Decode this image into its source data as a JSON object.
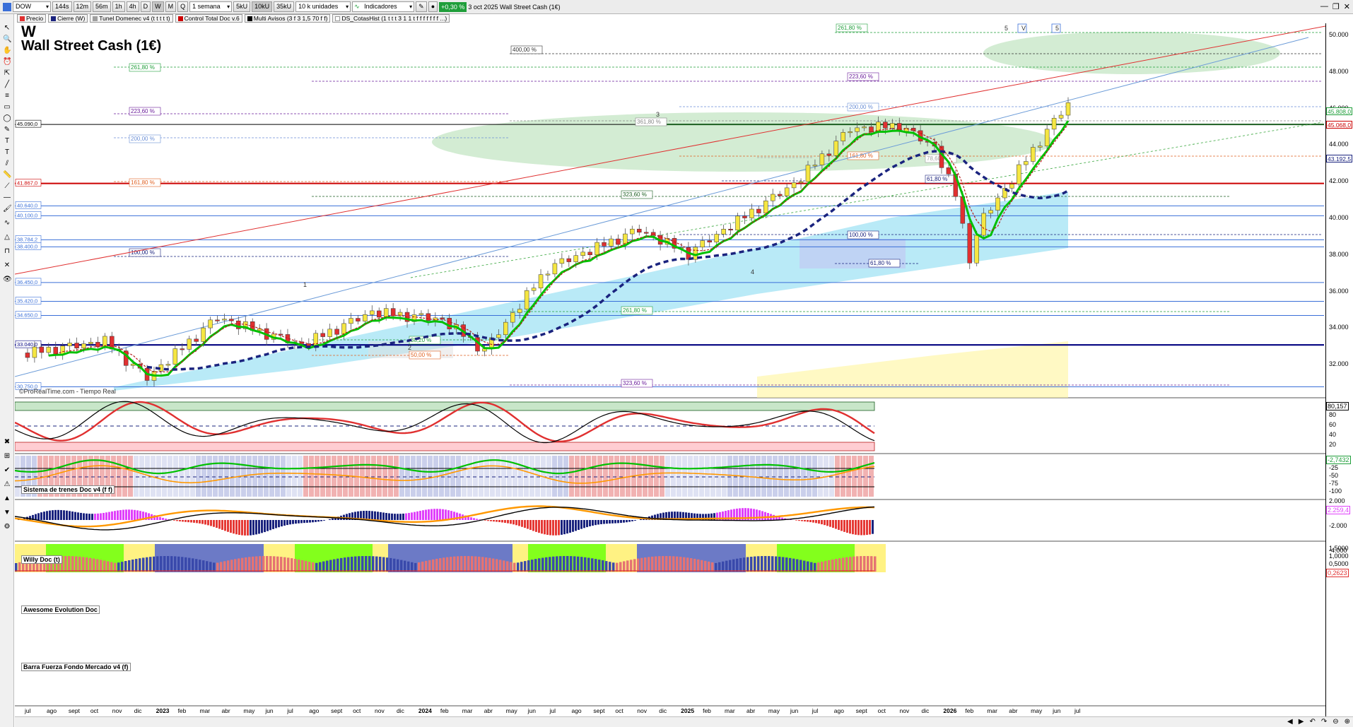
{
  "toolbar": {
    "symbol": "DOW",
    "periods": [
      "144s",
      "12m",
      "56m",
      "1h",
      "4h",
      "D",
      "W",
      "M",
      "Q"
    ],
    "active_period": "W",
    "range": "1 semana",
    "buttons2": [
      "5kU",
      "10kU",
      "35kU"
    ],
    "units": "10 k unidades",
    "indicators": "Indicadores",
    "change_badge": "+0,30 %",
    "date_title": "3 oct 2025 Wall Street Cash (1€)"
  },
  "studies": [
    "Precio",
    "Cierre (W)",
    "Tunel Domenec v4 (t t t t t)",
    "Control Total Doc v.6",
    "Multi Avisos (3 f 3 1,5 70 f f)",
    "DS_CotasHist (1 t t t 3 1 1 t f f f f f f f ...)"
  ],
  "chart_title": {
    "interval": "W",
    "name": "Wall Street Cash (1€)"
  },
  "watermark": "©ProRealTime.com - Tiempo Real",
  "panes": {
    "p1": "Sistema de trenes Doc v4 (f f)",
    "p2": "Willy Doc (t)",
    "p3": "Awesome Evolution Doc",
    "p4": "Barra Fuerza Fondo Mercado v4 (f)"
  },
  "x_labels": [
    "jul",
    "ago",
    "sept",
    "oct",
    "nov",
    "dic",
    "2023",
    "feb",
    "mar",
    "abr",
    "may",
    "jun",
    "jul",
    "ago",
    "sept",
    "oct",
    "nov",
    "dic",
    "2024",
    "feb",
    "mar",
    "abr",
    "may",
    "jun",
    "jul",
    "ago",
    "sept",
    "oct",
    "nov",
    "dic",
    "2025",
    "feb",
    "mar",
    "abr",
    "may",
    "jun",
    "jul",
    "ago",
    "sept",
    "oct",
    "nov",
    "dic",
    "2026",
    "feb",
    "mar",
    "abr",
    "may",
    "jun",
    "jul"
  ],
  "price_axis": [
    "50.000",
    "48.000",
    "46.000",
    "44.000",
    "42.000",
    "40.000",
    "38.000",
    "36.000",
    "34.000",
    "32.000"
  ],
  "price_tags": [
    {
      "text": "45.808,0",
      "color": "#1f9e3a"
    },
    {
      "text": "45.068,0",
      "color": "#cc0000"
    },
    {
      "text": "43.192,5",
      "color": "#1a237e"
    }
  ],
  "left_levels": [
    {
      "text": "45.090,0",
      "color": "#000000"
    },
    {
      "text": "41.867,0",
      "color": "#cc0000"
    },
    {
      "text": "40.640,0",
      "color": "#3a6fd8"
    },
    {
      "text": "40.100,0",
      "color": "#3a6fd8"
    },
    {
      "text": "38.784,2",
      "color": "#3a6fd8"
    },
    {
      "text": "38.400,0",
      "color": "#3a6fd8"
    },
    {
      "text": "36.450,0",
      "color": "#3a6fd8"
    },
    {
      "text": "35.420,0",
      "color": "#3a6fd8"
    },
    {
      "text": "34.650,0",
      "color": "#3a6fd8"
    },
    {
      "text": "33.040,0",
      "color": "#000080"
    },
    {
      "text": "30.750,0",
      "color": "#3a6fd8"
    }
  ],
  "fib_labels": [
    {
      "text": "261,80 %",
      "color": "#1f9e3a"
    },
    {
      "text": "400,00 %",
      "color": "#333333"
    },
    {
      "text": "261,80 %",
      "color": "#1f9e3a"
    },
    {
      "text": "223,60 %",
      "color": "#6a1b9a"
    },
    {
      "text": "223,60 %",
      "color": "#6a1b9a"
    },
    {
      "text": "200,00 %",
      "color": "#6b8fd6"
    },
    {
      "text": "361,80 %",
      "color": "#888888"
    },
    {
      "text": "200,00 %",
      "color": "#6b8fd6"
    },
    {
      "text": "161,80 %",
      "color": "#e06020"
    },
    {
      "text": "161,80 %",
      "color": "#e06020"
    },
    {
      "text": "323,60 %",
      "color": "#1b5e20"
    },
    {
      "text": "100,00 %",
      "color": "#1a237e"
    },
    {
      "text": "100,00 %",
      "color": "#1a237e"
    },
    {
      "text": "61,80 %",
      "color": "#1a237e"
    },
    {
      "text": "61,80 %",
      "color": "#1a237e"
    },
    {
      "text": "78,60 %",
      "color": "#9e9e9e"
    },
    {
      "text": "261,80 %",
      "color": "#1f9e3a"
    },
    {
      "text": "38,20 %",
      "color": "#1f9e3a"
    },
    {
      "text": "50,00 %",
      "color": "#e06020"
    },
    {
      "text": "323,60 %",
      "color": "#6a1b9a"
    }
  ],
  "wave_labels": [
    "1",
    "2",
    "3",
    "4",
    "5",
    "V",
    "5"
  ],
  "osc1_axis": [
    "80",
    "60",
    "40",
    "20"
  ],
  "osc1_value": "80,157",
  "osc2_axis": [
    "-25",
    "-50",
    "-75",
    "-100"
  ],
  "osc2_value": "-2,7432",
  "osc3_axis": [
    "2.000",
    "-2.000",
    "-4.000"
  ],
  "osc3_value": "2.259,4",
  "osc4_axis": [
    "1,5000",
    "1,0000",
    "0,5000"
  ],
  "osc4_value": "0,2623",
  "colors": {
    "bull": "#f5e642",
    "bear": "#e03030",
    "ma_fast": "#00c000",
    "ma_slow": "#1a237e"
  }
}
